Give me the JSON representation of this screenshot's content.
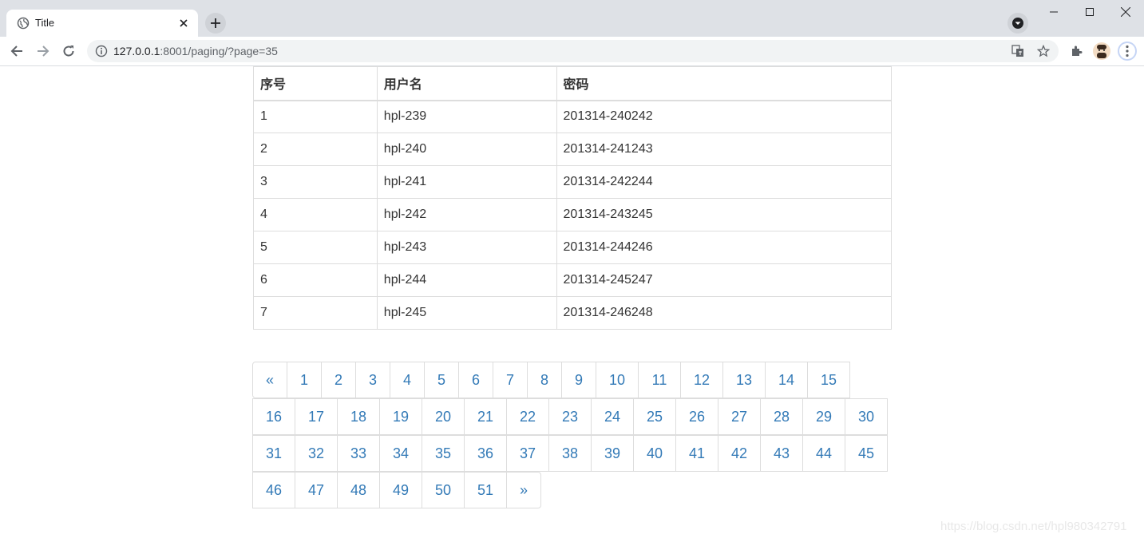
{
  "browser": {
    "tab_title": "Title",
    "url_host": "127.0.0.1",
    "url_rest": ":8001/paging/?page=35"
  },
  "table": {
    "headers": [
      "序号",
      "用户名",
      "密码"
    ],
    "rows": [
      [
        "1",
        "hpl-239",
        "201314-240242"
      ],
      [
        "2",
        "hpl-240",
        "201314-241243"
      ],
      [
        "3",
        "hpl-241",
        "201314-242244"
      ],
      [
        "4",
        "hpl-242",
        "201314-243245"
      ],
      [
        "5",
        "hpl-243",
        "201314-244246"
      ],
      [
        "6",
        "hpl-244",
        "201314-245247"
      ],
      [
        "7",
        "hpl-245",
        "201314-246248"
      ]
    ]
  },
  "pagination": {
    "prev": "«",
    "next": "»",
    "pages": [
      "1",
      "2",
      "3",
      "4",
      "5",
      "6",
      "7",
      "8",
      "9",
      "10",
      "11",
      "12",
      "13",
      "14",
      "15",
      "16",
      "17",
      "18",
      "19",
      "20",
      "21",
      "22",
      "23",
      "24",
      "25",
      "26",
      "27",
      "28",
      "29",
      "30",
      "31",
      "32",
      "33",
      "34",
      "35",
      "36",
      "37",
      "38",
      "39",
      "40",
      "41",
      "42",
      "43",
      "44",
      "45",
      "46",
      "47",
      "48",
      "49",
      "50",
      "51"
    ]
  },
  "watermark": "https://blog.csdn.net/hpl980342791",
  "colors": {
    "link": "#337ab7",
    "border": "#dddddd",
    "text": "#333333"
  }
}
